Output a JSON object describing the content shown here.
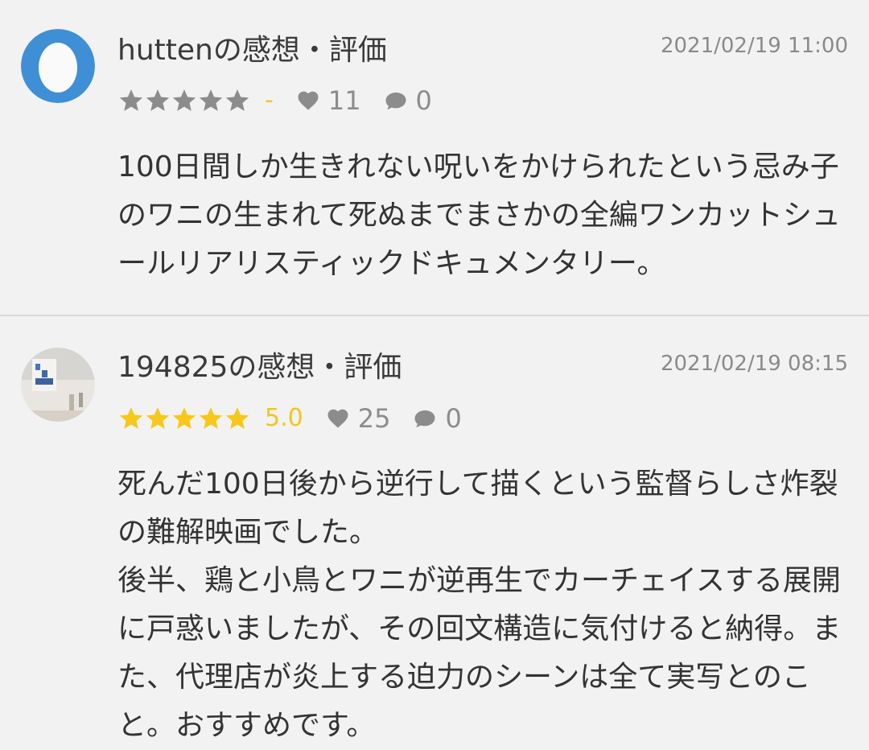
{
  "reviews": [
    {
      "name": "huttenの感想・評価",
      "date": "2021/02/19 11:00",
      "rating": 0,
      "score_text": "-",
      "likes": "11",
      "comments": "0",
      "body": "100日間しか生きれない呪いをかけられたという忌み子のワニの生まれて死ぬまでまさかの全編ワンカットシュールリアリスティックドキュメンタリー。",
      "avatar_icon": "egg-icon"
    },
    {
      "name": "194825の感想・評価",
      "date": "2021/02/19 08:15",
      "rating": 5,
      "score_text": "5.0",
      "likes": "25",
      "comments": "0",
      "body": "死んだ100日後から逆行して描くという監督らしさ炸裂の難解映画でした。\n後半、鶏と小鳥とワニが逆再生でカーチェイスする展開に戸惑いましたが、その回文構造に気付けると納得。また、代理店が炎上する迫力のシーンは全て実写とのこと。おすすめです。",
      "avatar_icon": "photo-avatar"
    }
  ],
  "colors": {
    "star_filled": "#f7c81a",
    "star_empty": "#8c8c8c",
    "score": "#f3c51f",
    "icon_gray": "#8c8c8c",
    "egg_bg": "#3f8fd6"
  }
}
